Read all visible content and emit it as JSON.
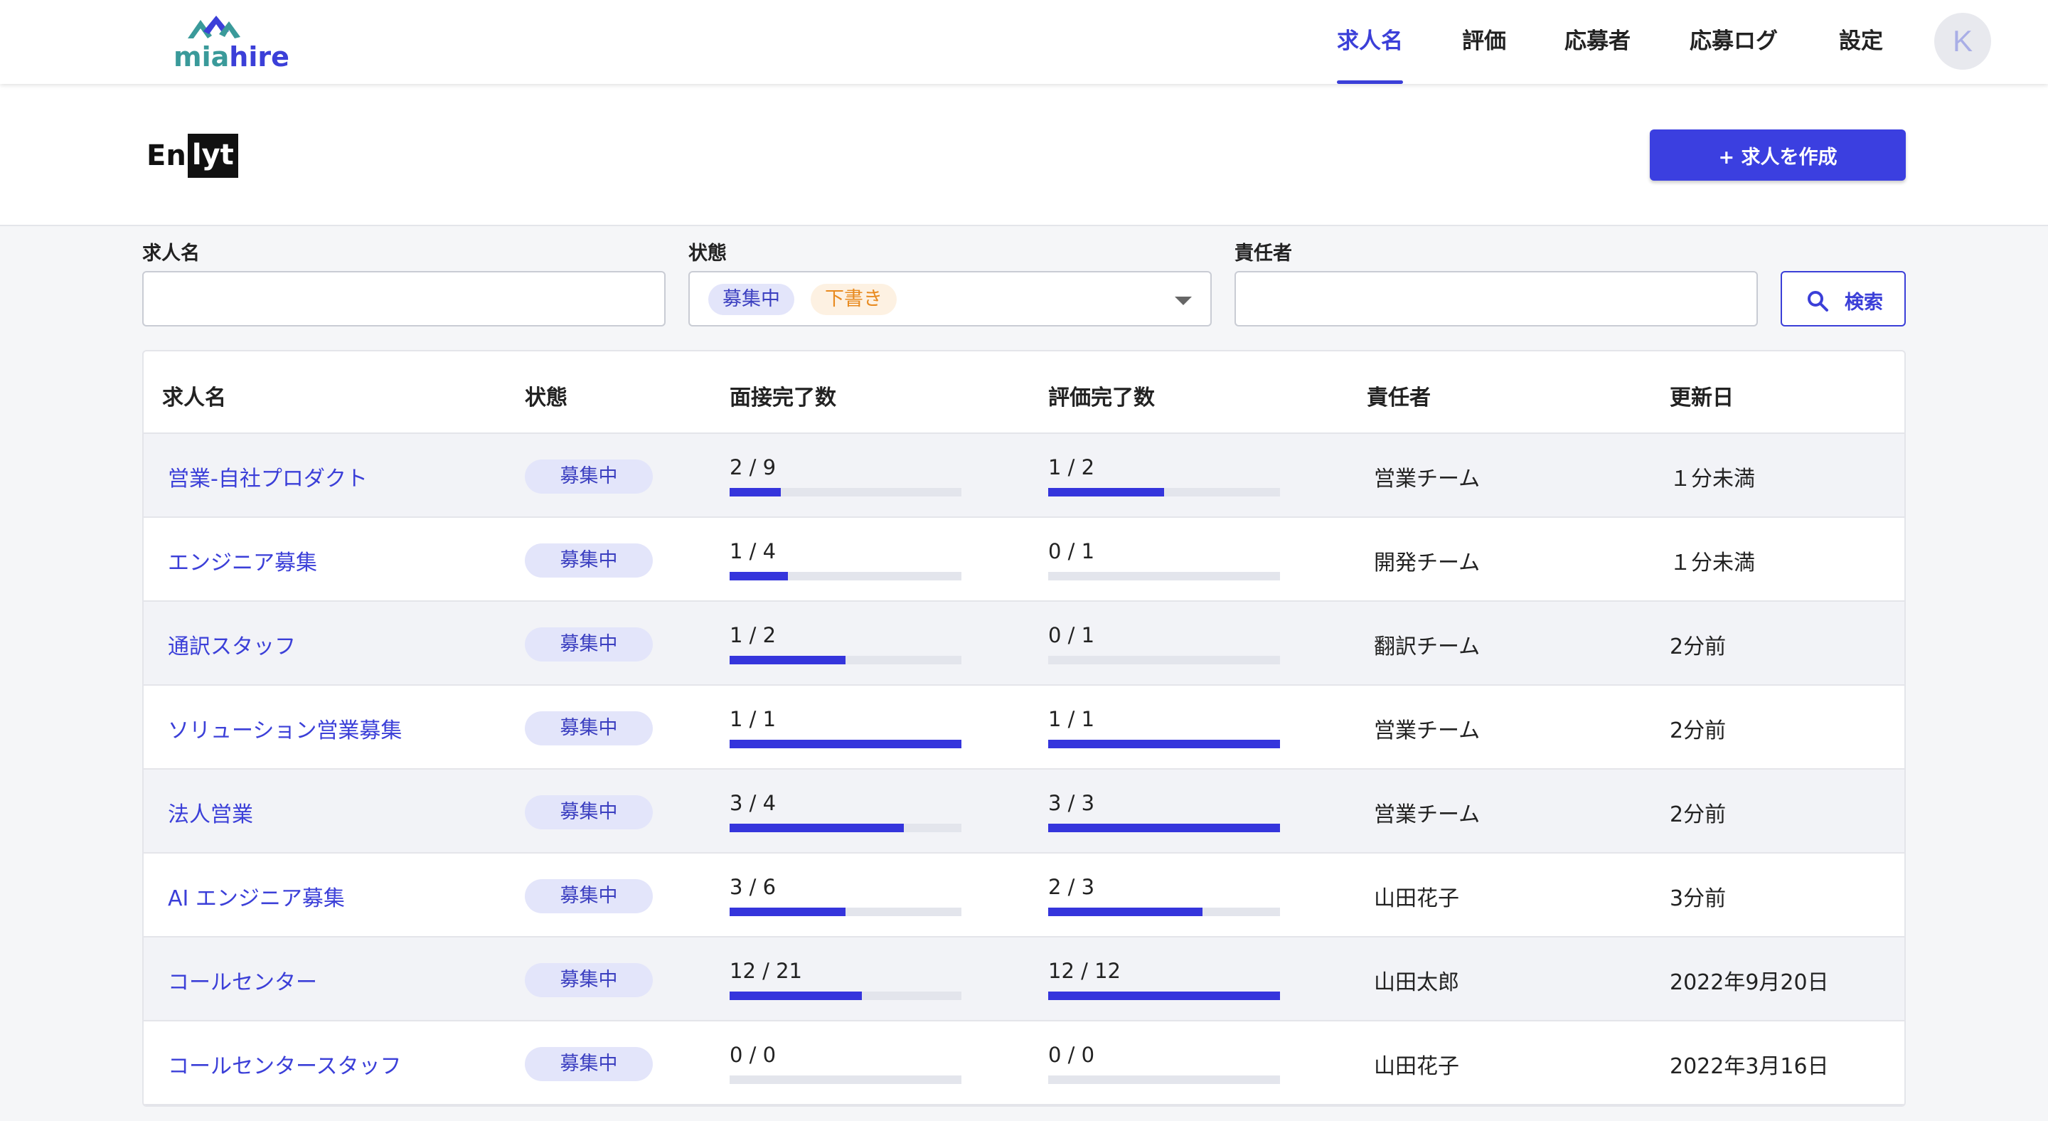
{
  "header": {
    "logo_mia": "mia",
    "logo_hire": "hire",
    "nav": [
      {
        "label": "求人名",
        "active": true
      },
      {
        "label": "評価",
        "active": false
      },
      {
        "label": "応募者",
        "active": false
      },
      {
        "label": "応募ログ",
        "active": false
      },
      {
        "label": "設定",
        "active": false
      }
    ],
    "avatar_initial": "K"
  },
  "company": {
    "logo_text_a": "En",
    "logo_text_b": "lyt",
    "create_button": "+ 求人を作成"
  },
  "filters": {
    "job_label": "求人名",
    "job_value": "",
    "status_label": "状態",
    "status_chips": [
      "募集中",
      "下書き"
    ],
    "owner_label": "責任者",
    "owner_value": "",
    "search_button": "検索"
  },
  "table": {
    "columns": [
      "求人名",
      "状態",
      "面接完了数",
      "評価完了数",
      "責任者",
      "更新日"
    ],
    "rows": [
      {
        "name": "営業-自社プロダクト",
        "status": "募集中",
        "interview": "2 / 9",
        "interview_ratio": 0.222,
        "eval": "1 / 2",
        "eval_ratio": 0.5,
        "owner": "営業チーム",
        "updated": "１分未満"
      },
      {
        "name": "エンジニア募集",
        "status": "募集中",
        "interview": "1 / 4",
        "interview_ratio": 0.25,
        "eval": "0 / 1",
        "eval_ratio": 0,
        "owner": "開発チーム",
        "updated": "１分未満"
      },
      {
        "name": "通訳スタッフ",
        "status": "募集中",
        "interview": "1 / 2",
        "interview_ratio": 0.5,
        "eval": "0 / 1",
        "eval_ratio": 0,
        "owner": "翻訳チーム",
        "updated": "2分前"
      },
      {
        "name": "ソリューション営業募集",
        "status": "募集中",
        "interview": "1 / 1",
        "interview_ratio": 1,
        "eval": "1 / 1",
        "eval_ratio": 1,
        "owner": "営業チーム",
        "updated": "2分前"
      },
      {
        "name": "法人営業",
        "status": "募集中",
        "interview": "3 / 4",
        "interview_ratio": 0.75,
        "eval": "3 / 3",
        "eval_ratio": 1,
        "owner": "営業チーム",
        "updated": "2分前"
      },
      {
        "name": "AI エンジニア募集",
        "status": "募集中",
        "interview": "3 / 6",
        "interview_ratio": 0.5,
        "eval": "2 / 3",
        "eval_ratio": 0.667,
        "owner": "山田花子",
        "updated": "3分前"
      },
      {
        "name": "コールセンター",
        "status": "募集中",
        "interview": "12 / 21",
        "interview_ratio": 0.571,
        "eval": "12 / 12",
        "eval_ratio": 1,
        "owner": "山田太郎",
        "updated": "2022年9月20日"
      },
      {
        "name": "コールセンタースタッフ",
        "status": "募集中",
        "interview": "0 / 0",
        "interview_ratio": 0,
        "eval": "0 / 0",
        "eval_ratio": 0,
        "owner": "山田花子",
        "updated": "2022年3月16日"
      }
    ]
  },
  "colors": {
    "accent": "#3b3fd8",
    "progress_fill": "#3535dc",
    "progress_track": "#e3e5ec",
    "chip_recruit_bg": "#e3e5fa",
    "chip_draft_bg": "#fdf1e2",
    "chip_draft_text": "#e88a1f"
  }
}
